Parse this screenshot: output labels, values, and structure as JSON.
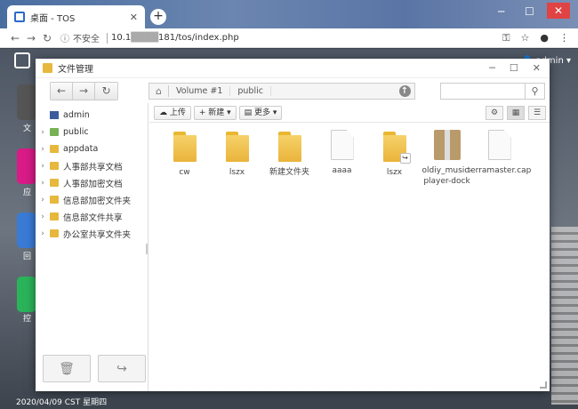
{
  "browser": {
    "tab_title": "桌面 - TOS",
    "tab_close": "✕",
    "new_tab": "+",
    "insecure_label": "不安全",
    "url_prefix": "10.1",
    "url_masked": "████",
    "url_suffix": "181/tos/index.php"
  },
  "desktop": {
    "user": "admin",
    "dock_labels": [
      "文",
      "应",
      "回",
      "控"
    ],
    "date_text": "2020/04/09 CST 星期四"
  },
  "window": {
    "title": "文件管理",
    "path": [
      "Volume #1",
      "public"
    ],
    "toolbar": {
      "upload": "上传",
      "new": "+ 新建 ▾",
      "more": "更多 ▾"
    },
    "sidebar": [
      {
        "label": "admin",
        "type": "user",
        "expandable": false
      },
      {
        "label": "public",
        "type": "share",
        "expandable": true
      },
      {
        "label": "appdata",
        "type": "folder",
        "expandable": true
      },
      {
        "label": "人事部共享文档",
        "type": "folder",
        "expandable": true
      },
      {
        "label": "人事部加密文档",
        "type": "folder",
        "expandable": true
      },
      {
        "label": "信息部加密文件夹",
        "type": "folder",
        "expandable": true
      },
      {
        "label": "信息部文件共享",
        "type": "folder",
        "expandable": true
      },
      {
        "label": "办公室共享文件夹",
        "type": "folder",
        "expandable": true
      }
    ],
    "files": [
      {
        "name": "cw",
        "kind": "folder"
      },
      {
        "name": "lszx",
        "kind": "folder"
      },
      {
        "name": "新建文件夹",
        "kind": "folder"
      },
      {
        "name": "aaaa",
        "kind": "doc"
      },
      {
        "name": "lszx",
        "kind": "folder-link"
      },
      {
        "name": "oldiy_music-player-dock",
        "kind": "package"
      },
      {
        "name": "terramaster.cap",
        "kind": "doc"
      }
    ]
  }
}
